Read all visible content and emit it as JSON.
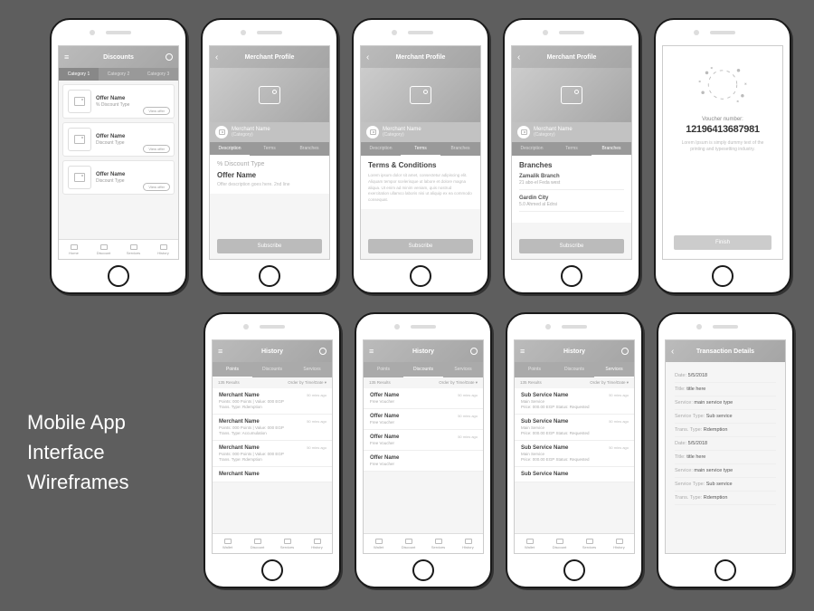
{
  "title_lines": [
    "Mobile App",
    "Interface",
    "Wireframes"
  ],
  "s1": {
    "header": "Discounts",
    "cats": [
      "Category 1",
      "Category 2",
      "Category 3"
    ],
    "offers": [
      {
        "name": "Offer Name",
        "sub": "% Discount Type",
        "btn": "View offer"
      },
      {
        "name": "Offer Name",
        "sub": "Discount Type",
        "btn": "View offer"
      },
      {
        "name": "Offer Name",
        "sub": "Discount Type",
        "btn": "View offer"
      }
    ],
    "tabbar": [
      "Home",
      "Discount",
      "Services",
      "History"
    ]
  },
  "merchant": {
    "header": "Merchant Profile",
    "name": "Merchant Name",
    "cat": "(Category)",
    "tabs": [
      "Description",
      "Terms",
      "Branches"
    ],
    "pct": "% Discount Type",
    "oname": "Offer Name",
    "desc": "Offer description goes here. 2nd line",
    "subscribe": "Subscribe",
    "tc_title": "Terms & Conditions",
    "tc_text": "Lorem ipsum dolor sit amet, consectetur adipiscing elit. Aliquam tempor scelerisque ut labore et dolore magna aliqua. Ut enim ad minim veniam, quis nostrud exercitation ullamco laboris nisi ut aliquip ex ea commodo consequat.",
    "branches_title": "Branches",
    "branches": [
      {
        "name": "Zamalik Branch",
        "addr": "21 abo-el Feda west"
      },
      {
        "name": "Gardin City",
        "addr": "5.0 Ahmed al Edrsi"
      }
    ]
  },
  "voucher": {
    "label": "Voucher number:",
    "num": "12196413687981",
    "text": "Lorem Ipsum is simply dummy text of the printing and typesetting industry.",
    "finish": "Finish"
  },
  "history": {
    "header": "History",
    "tabs": [
      "Points",
      "Discounts",
      "Services"
    ],
    "results": "135 Results",
    "order": "Order by  Time/Date ▾",
    "points_items": [
      {
        "name": "Merchant Name",
        "line1": "Points: 000 Points   |   Value: 000 EGP",
        "line2": "Trans. Type: Rdemption",
        "time": "50 mins ago"
      },
      {
        "name": "Merchant Name",
        "line1": "Points: 000 Points   |   Value: 000 EGP",
        "line2": "Trans. Type: Accumulation",
        "time": "50 mins ago"
      },
      {
        "name": "Merchant Name",
        "line1": "Points: 000 Points   |   Value: 000 EGP",
        "line2": "Trans. Type: Rdemption",
        "time": "50 mins ago"
      },
      {
        "name": "Merchant Name",
        "line1": "",
        "line2": "",
        "time": ""
      }
    ],
    "disc_items": [
      {
        "name": "Offer Name",
        "line1": "Free Voucher",
        "time": "50 mins ago"
      },
      {
        "name": "Offer Name",
        "line1": "Free Voucher",
        "time": "50 mins ago"
      },
      {
        "name": "Offer Name",
        "line1": "Free Voucher",
        "time": "50 mins ago"
      },
      {
        "name": "Offer Name",
        "line1": "Free Voucher",
        "time": ""
      }
    ],
    "serv_items": [
      {
        "name": "Sub Service Name",
        "line1": "Main Service",
        "line2": "Price: 000.00 EGP     Status: Requested",
        "time": "50 mins ago"
      },
      {
        "name": "Sub Service Name",
        "line1": "Main Service",
        "line2": "Price: 000.00 EGP     Status: Requested",
        "time": "50 mins ago"
      },
      {
        "name": " Sub Service Name",
        "line1": "Main Service",
        "line2": "Price: 000.00 EGP     Status: Requested",
        "time": "50 mins ago"
      },
      {
        "name": " Sub Service Name",
        "line1": "",
        "line2": "",
        "time": ""
      }
    ],
    "tabbar": [
      "Wallet",
      "Discount",
      "Services",
      "History"
    ]
  },
  "details": {
    "header": "Transaction Details",
    "rows": [
      {
        "lbl": "Date:",
        "val": " 5/5/2018"
      },
      {
        "lbl": "Title:",
        "val": " title here"
      },
      {
        "lbl": "Service:",
        "val": " main service type"
      },
      {
        "lbl": "Service Type:",
        "val": " Sub service"
      },
      {
        "lbl": "Trans. Type:",
        "val": " Rdemption"
      },
      {
        "lbl": "Date:",
        "val": " 5/5/2018"
      },
      {
        "lbl": "Title:",
        "val": " title here"
      },
      {
        "lbl": "Service:",
        "val": " main service type"
      },
      {
        "lbl": "Service Type:",
        "val": " Sub service"
      },
      {
        "lbl": "Trans. Type:",
        "val": " Rdemption"
      }
    ]
  }
}
